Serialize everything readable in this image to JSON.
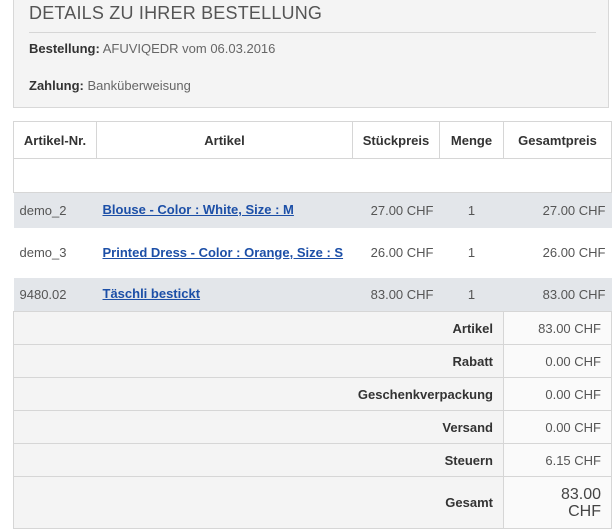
{
  "details": {
    "title": "DETAILS ZU IHRER BESTELLUNG",
    "order_label": "Bestellung:",
    "order_value": "AFUVIQEDR vom 06.03.2016",
    "payment_label": "Zahlung:",
    "payment_value": "Banküberweisung"
  },
  "table": {
    "headers": [
      "Artikel-Nr.",
      "Artikel",
      "Stückpreis",
      "Menge",
      "Gesamtpreis"
    ],
    "rows": [
      {
        "sku": "demo_2",
        "name": "Blouse - Color : White, Size : M",
        "unit_price": "27.00 CHF",
        "qty": "1",
        "total": "27.00 CHF"
      },
      {
        "sku": "demo_3",
        "name": "Printed Dress - Color : Orange, Size : S",
        "unit_price": "26.00 CHF",
        "qty": "1",
        "total": "26.00 CHF"
      },
      {
        "sku": "9480.02",
        "name": "Täschli bestickt",
        "unit_price": "83.00 CHF",
        "qty": "1",
        "total": "83.00 CHF"
      }
    ]
  },
  "summary": [
    {
      "label": "Artikel",
      "value": "83.00 CHF"
    },
    {
      "label": "Rabatt",
      "value": "0.00 CHF"
    },
    {
      "label": "Geschenkverpackung",
      "value": "0.00 CHF"
    },
    {
      "label": "Versand",
      "value": "0.00 CHF"
    },
    {
      "label": "Steuern",
      "value": "6.15 CHF"
    },
    {
      "label": "Gesamt",
      "value_line1": "83.00",
      "value_line2": "CHF"
    }
  ]
}
